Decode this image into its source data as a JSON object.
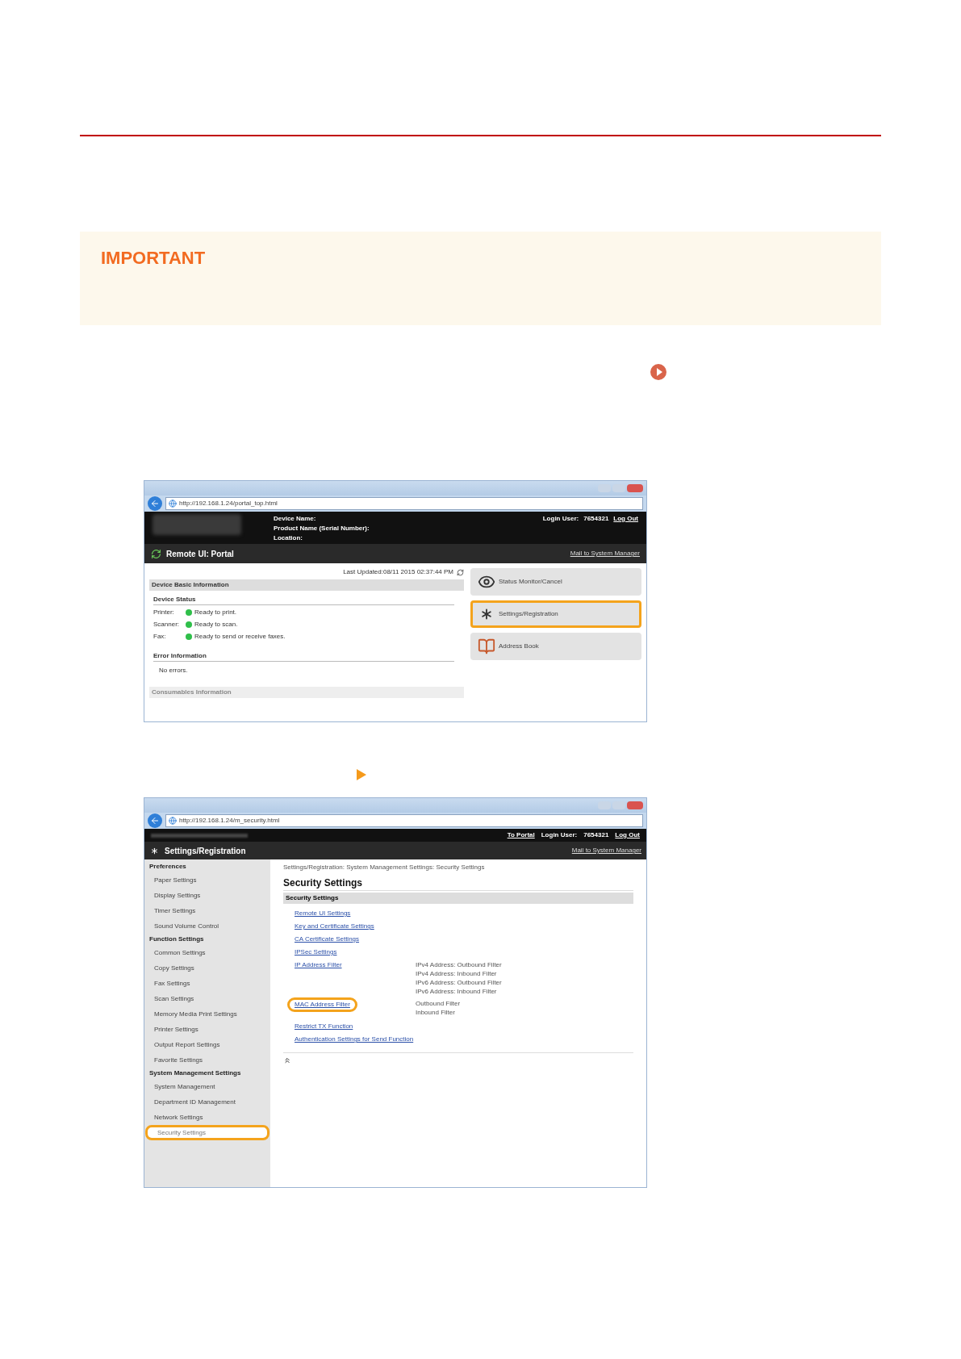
{
  "important": {
    "label": "IMPORTANT"
  },
  "portal_screen": {
    "url": "http://192.168.1.24/portal_top.html",
    "device_name_label": "Device Name:",
    "product_label": "Product Name (Serial Number):",
    "location_label": "Location:",
    "login_label": "Login User:",
    "login_user": "7654321",
    "logout": "Log Out",
    "title": "Remote UI: Portal",
    "mail_link": "Mail to System Manager",
    "last_updated": "Last Updated:08/11 2015 02:37:44 PM",
    "section": "Device Basic Information",
    "status_heading": "Device Status",
    "statuses": [
      {
        "label": "Printer:",
        "text": "Ready to print.",
        "color": "#2fbf4a"
      },
      {
        "label": "Scanner:",
        "text": "Ready to scan.",
        "color": "#2fbf4a"
      },
      {
        "label": "Fax:",
        "text": "Ready to send or receive faxes.",
        "color": "#2fbf4a"
      }
    ],
    "error_heading": "Error Information",
    "error_text": "No errors.",
    "faded_section": "Consumables Information",
    "menu": [
      {
        "label": "Status Monitor/Cancel",
        "highlighted": false
      },
      {
        "label": "Settings/Registration",
        "highlighted": true
      },
      {
        "label": "Address Book",
        "highlighted": false
      }
    ]
  },
  "security_screen": {
    "url": "http://192.168.1.24/m_security.html",
    "to_portal": "To Portal",
    "login_label": "Login User:",
    "login_user": "7654321",
    "logout": "Log Out",
    "title": "Settings/Registration",
    "mail_link": "Mail to System Manager",
    "sidebar": [
      {
        "heading": "Preferences",
        "items": [
          {
            "label": "Paper Settings",
            "highlighted": false
          },
          {
            "label": "Display Settings",
            "highlighted": false
          },
          {
            "label": "Timer Settings",
            "highlighted": false
          },
          {
            "label": "Sound Volume Control",
            "highlighted": false
          }
        ]
      },
      {
        "heading": "Function Settings",
        "items": [
          {
            "label": "Common Settings",
            "highlighted": false
          },
          {
            "label": "Copy Settings",
            "highlighted": false
          },
          {
            "label": "Fax Settings",
            "highlighted": false
          },
          {
            "label": "Scan Settings",
            "highlighted": false
          },
          {
            "label": "Memory Media Print Settings",
            "highlighted": false
          },
          {
            "label": "Printer Settings",
            "highlighted": false
          },
          {
            "label": "Output Report Settings",
            "highlighted": false
          },
          {
            "label": "Favorite Settings",
            "highlighted": false
          }
        ]
      },
      {
        "heading": "System Management Settings",
        "items": [
          {
            "label": "System Management",
            "highlighted": false
          },
          {
            "label": "Department ID Management",
            "highlighted": false
          },
          {
            "label": "Network Settings",
            "highlighted": false
          },
          {
            "label": "Security Settings",
            "highlighted": true
          }
        ]
      }
    ],
    "breadcrumb": "Settings/Registration: System Management Settings: Security Settings",
    "page_title": "Security Settings",
    "section": "Security Settings",
    "links": [
      {
        "label": "Remote UI Settings",
        "highlighted": false
      },
      {
        "label": "Key and Certificate Settings",
        "highlighted": false
      },
      {
        "label": "CA Certificate Settings",
        "highlighted": false
      },
      {
        "label": "IPSec Settings",
        "highlighted": false
      },
      {
        "label": "IP Address Filter",
        "highlighted": false,
        "notes": [
          "IPv4 Address: Outbound Filter",
          "IPv4 Address: Inbound Filter",
          "IPv6 Address: Outbound Filter",
          "IPv6 Address: Inbound Filter"
        ]
      },
      {
        "label": "MAC Address Filter",
        "highlighted": true,
        "notes": [
          "Outbound Filter",
          "Inbound Filter"
        ]
      },
      {
        "label": "Restrict TX Function",
        "highlighted": false
      },
      {
        "label": "Authentication Settings for Send Function",
        "highlighted": false
      }
    ]
  }
}
